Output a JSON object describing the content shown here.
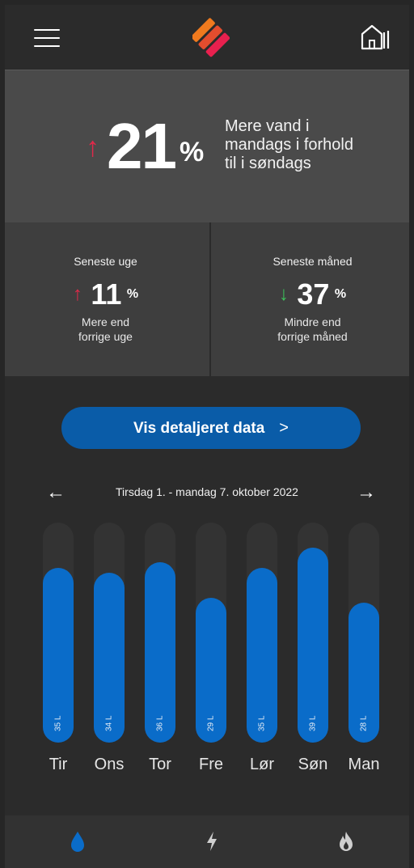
{
  "hero": {
    "percent": "21",
    "percent_sign": "%",
    "arrow": "↑",
    "text": "Mere vand i\nmandags i forhold\ntil i søndags"
  },
  "stats": {
    "week": {
      "title": "Seneste uge",
      "arrow": "↑",
      "value": "11",
      "percent_sign": "%",
      "desc": "Mere end\nforrige uge",
      "trend": "up"
    },
    "month": {
      "title": "Seneste måned",
      "arrow": "↓",
      "value": "37",
      "percent_sign": "%",
      "desc": "Mindre end\nforrige måned",
      "trend": "down"
    }
  },
  "cta": {
    "label": "Vis detaljeret data",
    "chevron": ">"
  },
  "period": {
    "label": "Tirsdag 1. - mandag 7. oktober 2022",
    "prev": "←",
    "next": "→"
  },
  "chart_data": {
    "type": "bar",
    "categories": [
      "Tir",
      "Ons",
      "Tor",
      "Fre",
      "Lør",
      "Søn",
      "Man"
    ],
    "values": [
      35,
      34,
      36,
      29,
      35,
      39,
      28
    ],
    "value_labels": [
      "35 L",
      "34 L",
      "36 L",
      "29 L",
      "35 L",
      "39 L",
      "28 L"
    ],
    "unit": "L",
    "ylim": [
      0,
      44
    ]
  },
  "colors": {
    "accent": "#0a6cc9",
    "cta": "#0a5ca8",
    "up": "#e0294a",
    "down": "#3cc25a",
    "logo_top": "#f07a1e",
    "logo_bottom": "#e8204e"
  },
  "icons": {
    "menu": "hamburger-menu-icon",
    "home": "smart-home-icon",
    "water": "water-drop-icon",
    "power": "lightning-bolt-icon",
    "heat": "flame-icon"
  }
}
